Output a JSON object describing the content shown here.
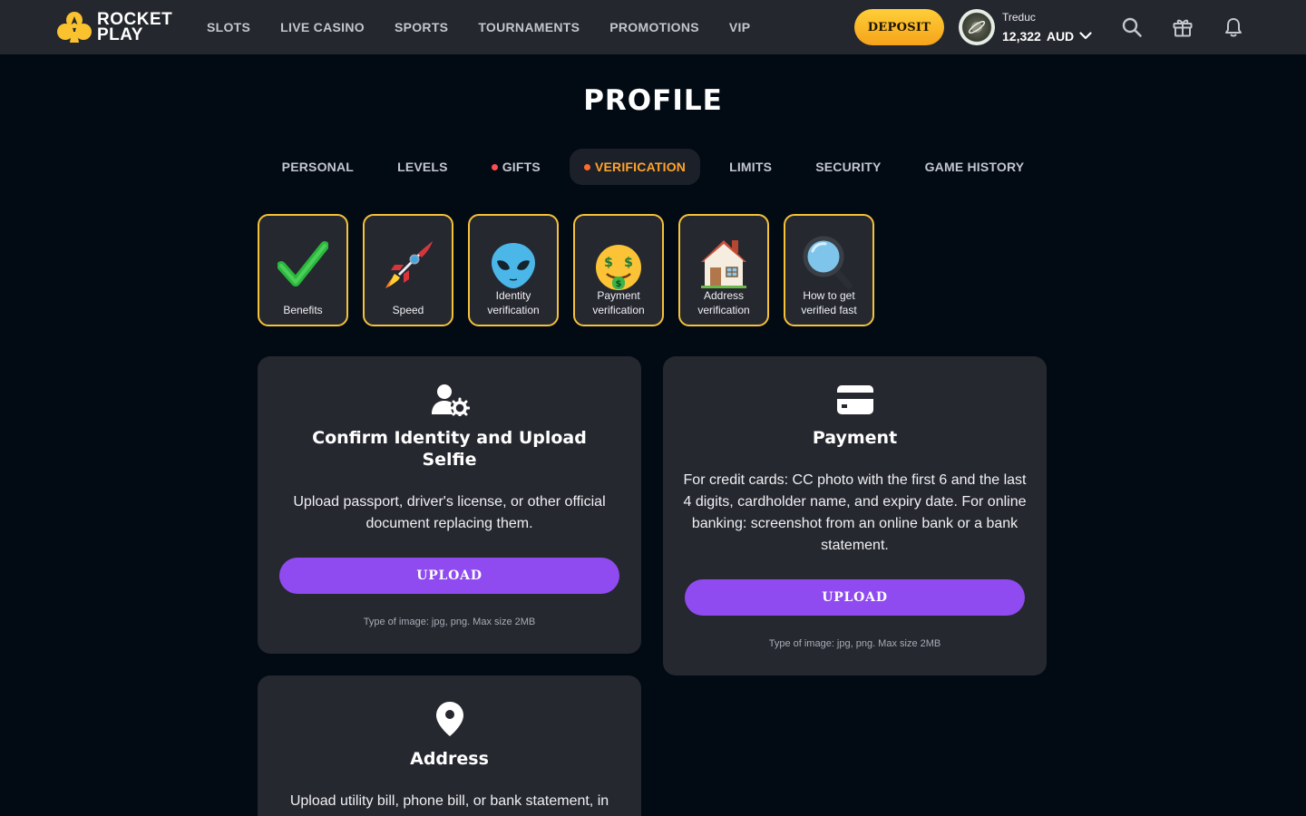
{
  "header": {
    "logo": {
      "line1": "ROCKET",
      "line2": "PLAY"
    },
    "nav": [
      "SLOTS",
      "LIVE CASINO",
      "SPORTS",
      "TOURNAMENTS",
      "PROMOTIONS",
      "VIP"
    ],
    "deposit_label": "DEPOSIT",
    "user": {
      "name": "Treduc",
      "balance": "12,322",
      "currency": "AUD"
    },
    "icons": [
      "search-icon",
      "gift-icon",
      "bell-icon"
    ]
  },
  "page": {
    "title": "PROFILE"
  },
  "tabs": [
    {
      "label": "PERSONAL",
      "dot": false,
      "active": false
    },
    {
      "label": "LEVELS",
      "dot": false,
      "active": false
    },
    {
      "label": "GIFTS",
      "dot": true,
      "active": false
    },
    {
      "label": "VERIFICATION",
      "dot": true,
      "active": true
    },
    {
      "label": "LIMITS",
      "dot": false,
      "active": false
    },
    {
      "label": "SECURITY",
      "dot": false,
      "active": false
    },
    {
      "label": "GAME HISTORY",
      "dot": false,
      "active": false
    }
  ],
  "info_cards": [
    {
      "label": "Benefits",
      "icon": "checkmark-icon"
    },
    {
      "label": "Speed",
      "icon": "rocket-icon"
    },
    {
      "label": "Identity verification",
      "icon": "alien-icon"
    },
    {
      "label": "Payment verification",
      "icon": "money-face-icon"
    },
    {
      "label": "Address verification",
      "icon": "house-icon"
    },
    {
      "label": "How to get verified fast",
      "icon": "magnifier-icon"
    }
  ],
  "verification": {
    "identity": {
      "title": "Confirm Identity and Upload Selfie",
      "description": "Upload passport, driver's license, or other official document replacing them.",
      "button": "UPLOAD",
      "note": "Type of image: jpg, png. Max size 2MB"
    },
    "payment": {
      "title": "Payment",
      "description": "For credit cards: CC photo with the first 6 and the last 4 digits, cardholder name, and expiry date. For online banking: screenshot from an online bank or a bank statement.",
      "button": "UPLOAD",
      "note": "Type of image: jpg, png. Max size 2MB"
    },
    "address": {
      "title": "Address",
      "description": "Upload utility bill, phone bill, or bank statement, in"
    }
  },
  "colors": {
    "background": "#020a13",
    "header": "#25272e",
    "card": "#262830",
    "accent_orange": "#ffa42c",
    "deposit": "#ffc02e",
    "upload": "#8f4bf0",
    "card_border": "#f5c23a"
  }
}
